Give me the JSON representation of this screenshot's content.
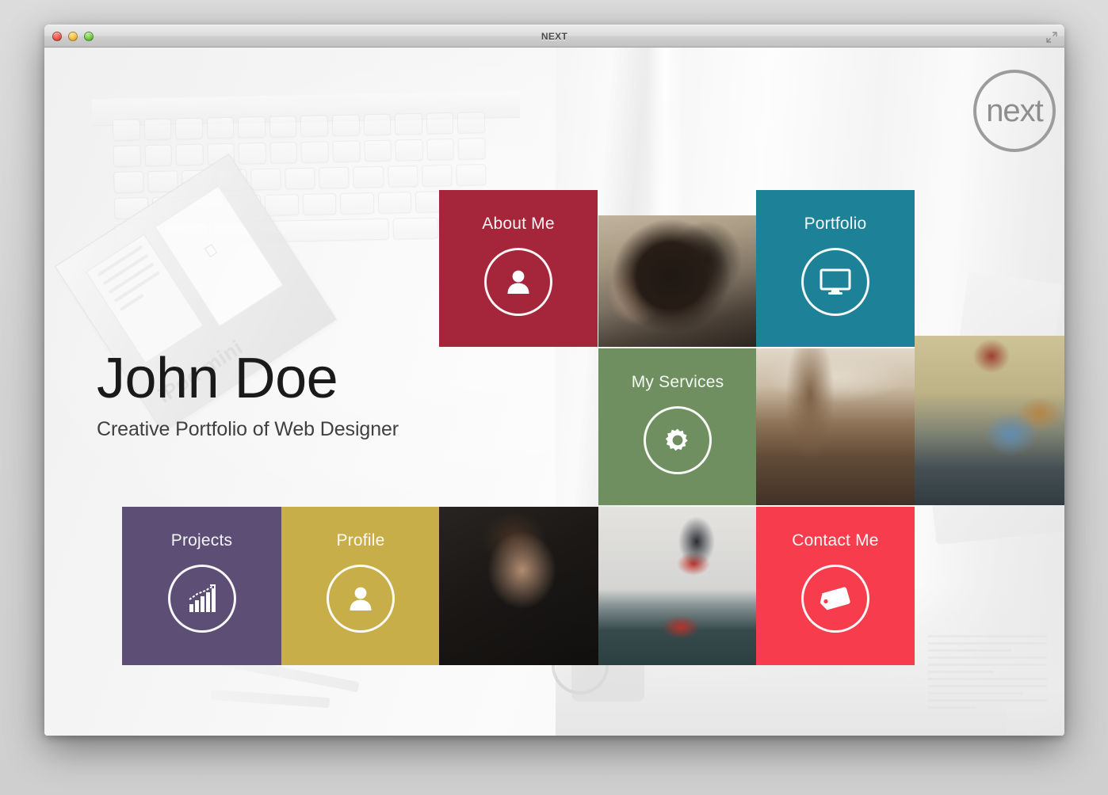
{
  "window": {
    "title": "NEXT",
    "controls": {
      "close": "close",
      "minimize": "minimize",
      "zoom": "zoom"
    },
    "fullscreen_label": "Enter Full Screen"
  },
  "brand": {
    "logo_text": "next"
  },
  "hero": {
    "name": "John Doe",
    "subtitle": "Creative Portfolio of Web Designer"
  },
  "colors": {
    "about": "#a5253a",
    "portfolio": "#1d8297",
    "services": "#6f8f60",
    "projects": "#5d4e76",
    "profile": "#c7ae49",
    "contact": "#f73c4d",
    "logo_grey": "#9c9c9c",
    "hero_name": "#1a1a1a",
    "hero_sub": "#404040"
  },
  "tiles": [
    {
      "id": "about",
      "label": "About Me",
      "icon": "person-icon",
      "kind": "color",
      "color": "#a5253a"
    },
    {
      "id": "portfolio",
      "label": "Portfolio",
      "icon": "monitor-icon",
      "kind": "color",
      "color": "#1d8297"
    },
    {
      "id": "services",
      "label": "My Services",
      "icon": "gear-icon",
      "kind": "color",
      "color": "#6f8f60"
    },
    {
      "id": "projects",
      "label": "Projects",
      "icon": "bar-chart-icon",
      "kind": "color",
      "color": "#5d4e76"
    },
    {
      "id": "profile",
      "label": "Profile",
      "icon": "person-icon",
      "kind": "color",
      "color": "#c7ae49"
    },
    {
      "id": "contact",
      "label": "Contact Me",
      "icon": "tag-icon",
      "kind": "color",
      "color": "#f73c4d"
    }
  ],
  "photos": [
    {
      "id": "camera",
      "alt": "Photographer holding a camera to their face"
    },
    {
      "id": "legs",
      "alt": "Legs of a person standing on a road at sunset next to a bag"
    },
    {
      "id": "falling",
      "alt": "Man falling backwards on asphalt with papers and a bag in mid-air"
    },
    {
      "id": "portrait",
      "alt": "Dark moody portrait of a young man adjusting his collar"
    },
    {
      "id": "room",
      "alt": "Man lifting another person by the legs in a white room"
    }
  ]
}
